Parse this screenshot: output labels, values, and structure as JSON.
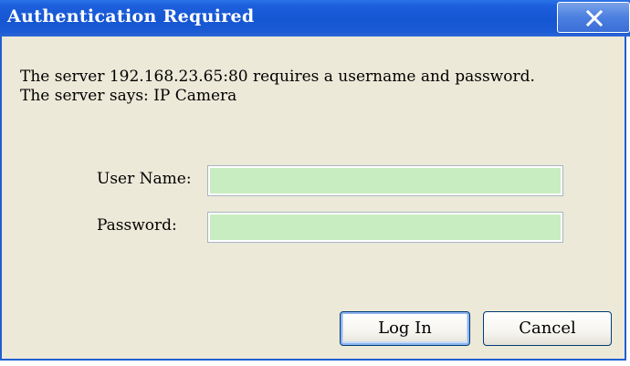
{
  "window": {
    "title": "Authentication Required",
    "close_icon": "close-icon"
  },
  "message": {
    "line1": "The server 192.168.23.65:80 requires a username and password.",
    "line2": "The server says: IP Camera"
  },
  "form": {
    "username_label": "User Name:",
    "username_value": "",
    "password_label": "Password:",
    "password_value": ""
  },
  "buttons": {
    "login_label": "Log In",
    "cancel_label": "Cancel"
  },
  "colors": {
    "titlebar": "#1556d2",
    "dialog_background": "#ece9d8",
    "input_background": "#c8edc0",
    "button_border": "#003c74"
  }
}
